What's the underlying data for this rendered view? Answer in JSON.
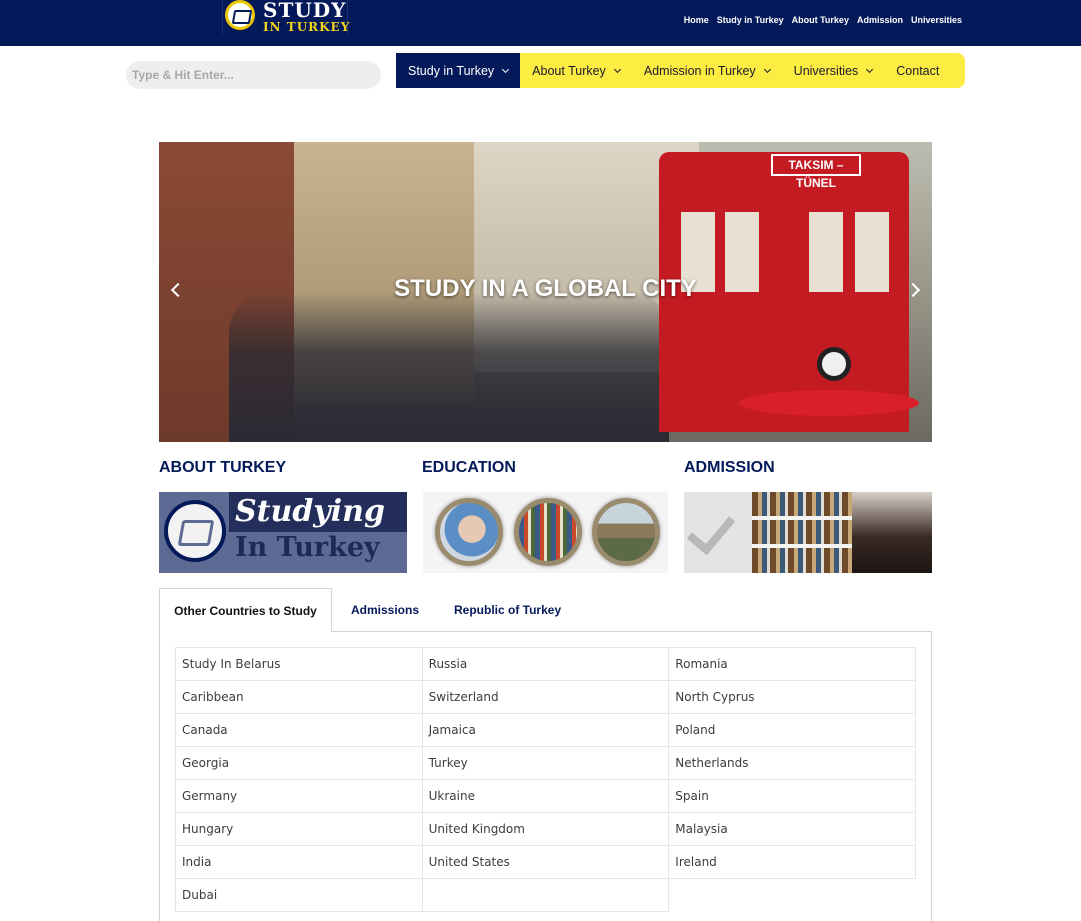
{
  "header": {
    "logo": {
      "line1": "STUDY",
      "line2": "IN TURKEY"
    },
    "top_nav": [
      "Home",
      "Study in Turkey",
      "About Turkey",
      "Admission",
      "Universities"
    ]
  },
  "search": {
    "placeholder": "Type & Hit Enter..."
  },
  "main_nav": [
    {
      "label": "Study in Turkey",
      "has_dropdown": true,
      "active": true
    },
    {
      "label": "About Turkey",
      "has_dropdown": true
    },
    {
      "label": "Admission in Turkey",
      "has_dropdown": true
    },
    {
      "label": "Universities",
      "has_dropdown": true
    },
    {
      "label": "Contact",
      "has_dropdown": false
    }
  ],
  "hero": {
    "title": "STUDY IN A GLOBAL CITY",
    "tram_sign": "TAKSIM – TÜNEL"
  },
  "cards": [
    {
      "title": "ABOUT TURKEY",
      "image_text": [
        "Studying",
        "In Turkey"
      ]
    },
    {
      "title": "EDUCATION"
    },
    {
      "title": "ADMISSION"
    }
  ],
  "tabs": [
    "Other Countries to Study",
    "Admissions",
    "Republic of Turkey"
  ],
  "countries": [
    [
      "Study In Belarus",
      "Russia",
      "Romania"
    ],
    [
      "Caribbean",
      "Switzerland",
      "North Cyprus"
    ],
    [
      "Canada",
      "Jamaica",
      "Poland"
    ],
    [
      "Georgia",
      "Turkey",
      "Netherlands"
    ],
    [
      "Germany",
      "Ukraine",
      "Spain"
    ],
    [
      "Hungary",
      "United Kingdom",
      "Malaysia"
    ],
    [
      "India",
      "United States",
      "Ireland"
    ],
    [
      "Dubai",
      "",
      ""
    ]
  ],
  "colors": {
    "navy": "#04195a",
    "yellow": "#fdec42",
    "tram_red": "#c41a22"
  }
}
